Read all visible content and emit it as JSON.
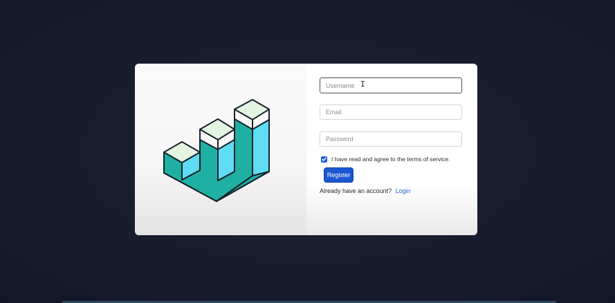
{
  "form": {
    "username_placeholder": "Username",
    "email_placeholder": "Email",
    "password_placeholder": "Password",
    "terms_label": "I have read and agree to the terms of service.",
    "terms_checked": true,
    "register_label": "Register",
    "already_text": "Already have an account?",
    "login_label": "Login"
  },
  "logo": {
    "icon": "isometric-bar-chart-logo",
    "colors": {
      "teal": "#1fb0a3",
      "cyan": "#5fdcf3",
      "mint_top": "#e3f5e1",
      "outline": "#16202a"
    }
  },
  "colors": {
    "background": "#171c2e",
    "accent": "#1b57d0",
    "link": "#2a63c8"
  }
}
